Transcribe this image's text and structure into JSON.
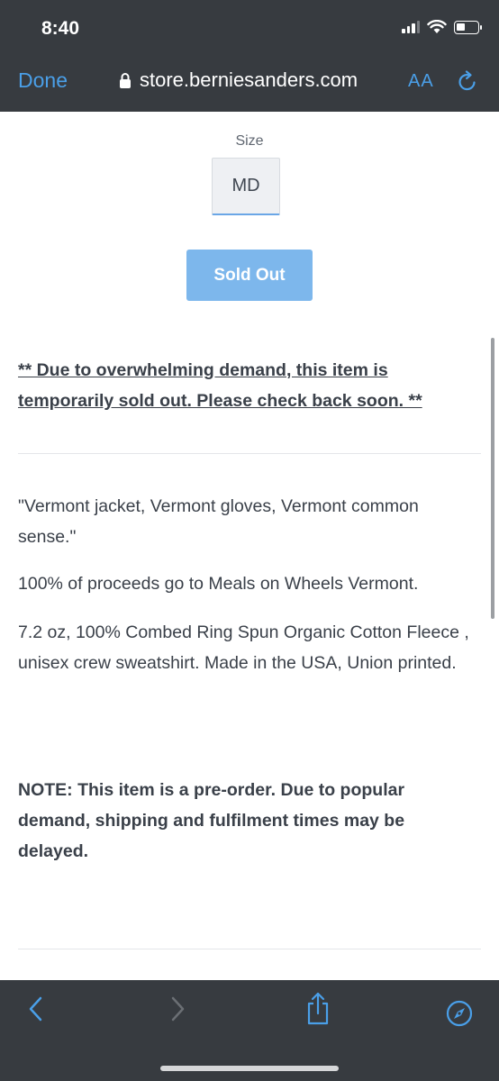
{
  "status_bar": {
    "time": "8:40"
  },
  "browser": {
    "done_label": "Done",
    "url": "store.berniesanders.com",
    "text_size_label": "AA",
    "accent": "#4a9fe8",
    "toolbar_bg": "#373b40"
  },
  "product": {
    "size_label": "Size",
    "size_value": "MD",
    "button_label": "Sold Out",
    "notice": "** Due to overwhelming demand, this item is temporarily sold out. Please check back soon. **",
    "quote": " \"Vermont jacket, Vermont gloves, Vermont common sense.\"",
    "proceeds": "100% of proceeds go to Meals on Wheels Vermont.",
    "specs": "7.2 oz, 100% Combed Ring Spun Organic Cotton Fleece , unisex crew sweatshirt. Made in the USA, Union printed.",
    "note": "NOTE: This item is a pre-order. Due to popular demand, shipping and fulfilment times may be delayed."
  },
  "toolbar": {
    "icons": [
      "back-icon",
      "forward-icon",
      "share-icon",
      "compass-icon"
    ]
  }
}
